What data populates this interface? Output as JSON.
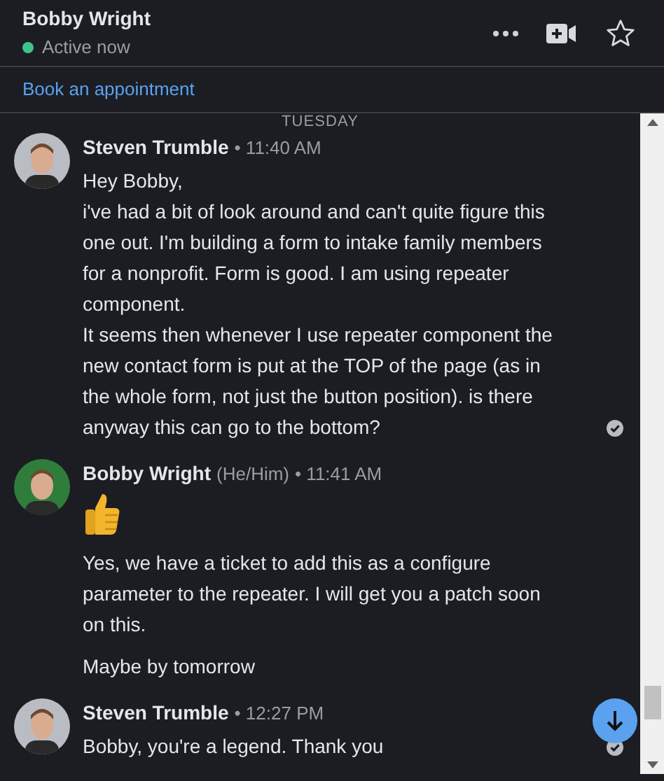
{
  "header": {
    "name": "Bobby Wright",
    "status": "Active now",
    "online": true
  },
  "link": "Book an appointment",
  "date_divider": "TUESDAY",
  "messages": [
    {
      "author": "Steven Trumble",
      "time": "• 11:40 AM",
      "avatar": {
        "color": "#b9bcc2"
      },
      "read": true,
      "blocks": [
        {
          "kind": "lines",
          "lines": [
            "Hey Bobby,",
            "i've had a bit of look around and can't quite figure this one out. I'm building a form to intake family members for a nonprofit. Form is good. I am using repeater component.",
            "It seems then whenever I use repeater component the new contact form is put at the TOP of the page (as in the whole form, not just the button position). is there anyway this can go to the bottom?"
          ]
        }
      ]
    },
    {
      "author": "Bobby Wright",
      "pronouns": "(He/Him)",
      "time": "• 11:41 AM",
      "avatar": {
        "color": "#2f7d3a"
      },
      "read": false,
      "blocks": [
        {
          "kind": "thumbs_up"
        },
        {
          "kind": "lines",
          "lines": [
            "Yes, we have a ticket to add this as a configure parameter to the repeater. I will get you a patch soon on this."
          ]
        },
        {
          "kind": "lines",
          "lines": [
            "Maybe by tomorrow"
          ]
        }
      ]
    },
    {
      "author": "Steven Trumble",
      "time": "• 12:27 PM",
      "avatar": {
        "color": "#b9bcc2"
      },
      "read": true,
      "blocks": [
        {
          "kind": "lines",
          "lines": [
            "Bobby, you're a legend. Thank you"
          ]
        }
      ]
    }
  ]
}
